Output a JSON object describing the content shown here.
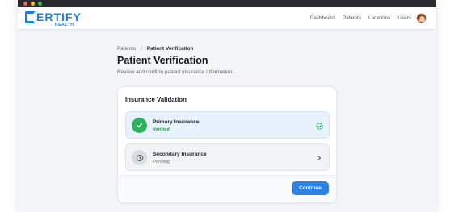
{
  "brand": {
    "logo_text": "ERTIFY",
    "logo_sub": "HEALTH",
    "color": "#1c7fd8"
  },
  "nav": {
    "links": [
      "Dashboard",
      "Patients",
      "Locations",
      "Users"
    ]
  },
  "breadcrumb": {
    "parent": "Patients",
    "separator": "/",
    "current": "Patient Verification"
  },
  "page": {
    "title": "Patient Verification",
    "subtitle": "Review and confirm patient insurance information."
  },
  "card": {
    "title": "Insurance Validation",
    "items": [
      {
        "label": "Primary Insurance",
        "status": "Verified",
        "icon": "check-icon",
        "end_icon": "check-circle-icon",
        "state_color": "#2cb45a"
      },
      {
        "label": "Secondary Insurance",
        "status": "Pending",
        "icon": "clock-icon",
        "end_icon": "chevron-right-icon",
        "state_color": "#6b7280"
      }
    ],
    "continue_label": "Continue",
    "accent": "#2b84e3"
  }
}
